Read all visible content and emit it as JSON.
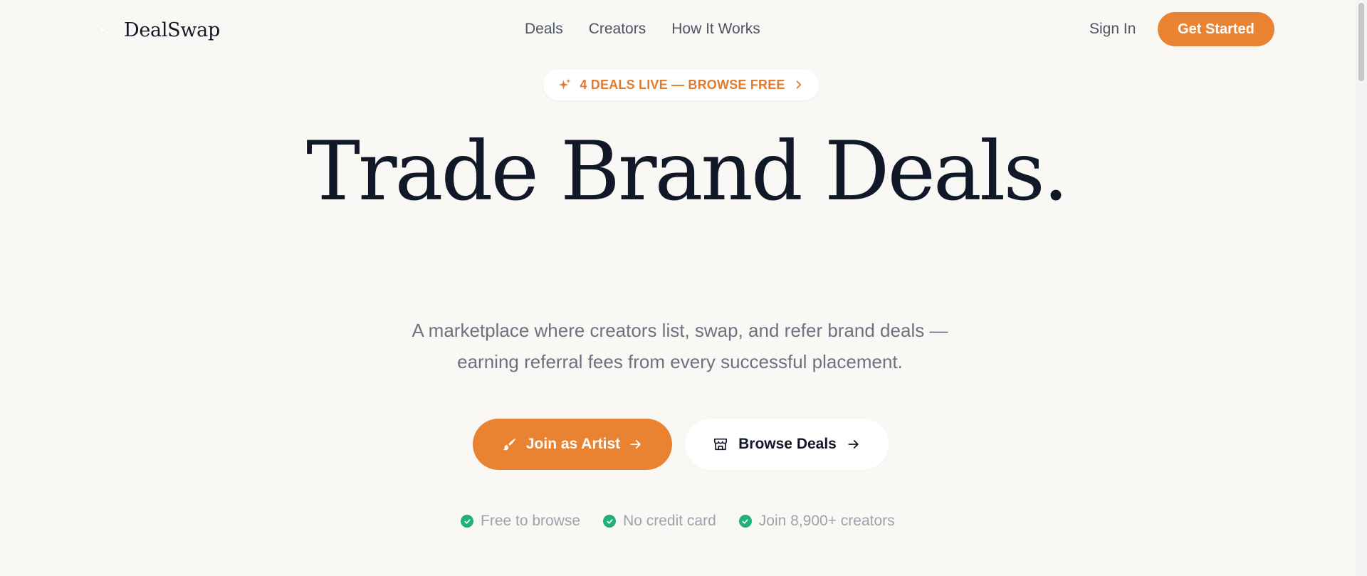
{
  "brand": {
    "name": "DealSwap",
    "logo_icon": "sparkle-icon"
  },
  "nav": {
    "items": [
      {
        "label": "Deals"
      },
      {
        "label": "Creators"
      },
      {
        "label": "How It Works"
      }
    ]
  },
  "header": {
    "signin_label": "Sign In",
    "get_started_label": "Get Started"
  },
  "badge": {
    "text": "4 DEALS LIVE — BROWSE FREE",
    "icon": "sparkles-icon",
    "trailing_icon": "chevron-right-icon"
  },
  "hero": {
    "headline": "Trade Brand Deals.",
    "subtitle_line1": "A marketplace where creators list, swap, and refer brand deals —",
    "subtitle_line2": "earning referral fees from every successful placement."
  },
  "cta": {
    "primary_label": "Join as Artist",
    "primary_icon": "paintbrush-icon",
    "secondary_label": "Browse Deals",
    "secondary_icon": "store-icon"
  },
  "features": [
    {
      "label": "Free to browse"
    },
    {
      "label": "No credit card"
    },
    {
      "label": "Join 8,900+ creators"
    }
  ],
  "colors": {
    "accent": "#ea8331",
    "badge_text": "#e07b2f",
    "check": "#22b07d",
    "background": "#faf8f5",
    "heading": "#111827",
    "muted": "#6b7280"
  }
}
